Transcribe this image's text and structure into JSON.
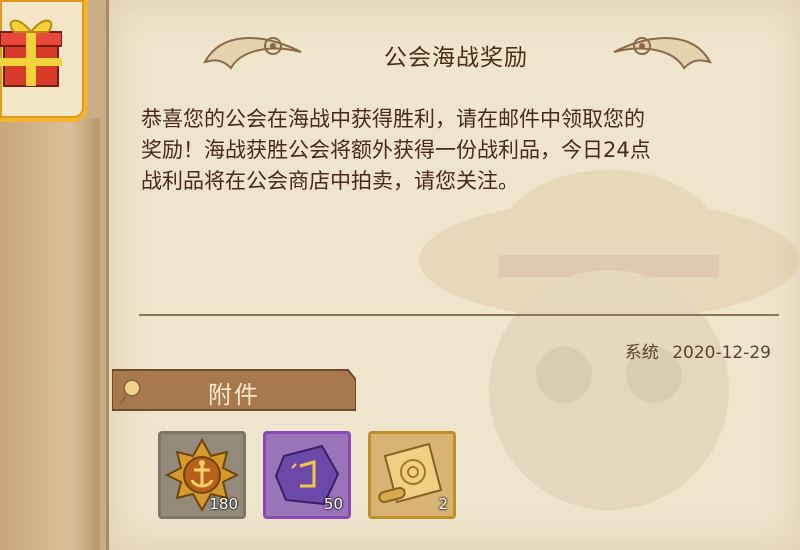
{
  "gift_card": {
    "icon": "gift-box-icon"
  },
  "mail": {
    "title": "公会海战奖励",
    "body_lines": [
      "恭喜您的公会在海战中获得胜利，请在邮件中领取您的",
      "奖励！海战获胜公会将额外获得一份战利品，今日24点",
      "战利品将在公会商店中拍卖，请您关注。"
    ],
    "sender": "系统",
    "date": "2020-12-29"
  },
  "attachments": {
    "label": "附件",
    "items": [
      {
        "icon": "anchor-medal-icon",
        "count": "180",
        "rarity_color": "#7d7566"
      },
      {
        "icon": "purple-rune-stone-icon",
        "count": "50",
        "rarity_color": "#8a49b5"
      },
      {
        "icon": "treasure-map-scroll-icon",
        "count": "2",
        "rarity_color": "#bf8f2c"
      }
    ]
  }
}
